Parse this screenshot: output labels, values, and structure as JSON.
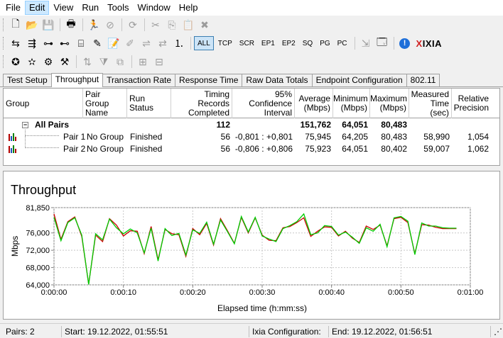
{
  "menu": [
    "File",
    "Edit",
    "View",
    "Run",
    "Tools",
    "Window",
    "Help"
  ],
  "menu_active": "Edit",
  "toolbar_protocols": [
    "ALL",
    "TCP",
    "SCR",
    "EP1",
    "EP2",
    "SQ",
    "PG",
    "PC"
  ],
  "brand": {
    "prefix": "",
    "x": "X",
    "rest": "IXIA"
  },
  "tabs": [
    "Test Setup",
    "Throughput",
    "Transaction Rate",
    "Response Time",
    "Raw Data Totals",
    "Endpoint Configuration",
    "802.11"
  ],
  "active_tab": "Throughput",
  "table": {
    "headers": {
      "group": "Group",
      "pair_group": "Pair Group Name",
      "run_status": "Run Status",
      "timing": "Timing Records Completed",
      "confidence": "95% Confidence Interval",
      "average": "Average (Mbps)",
      "minimum": "Minimum (Mbps)",
      "maximum": "Maximum (Mbps)",
      "measured": "Measured Time (sec)",
      "relative": "Relative Precision"
    },
    "all_pairs": {
      "label": "All Pairs",
      "timing": "112",
      "average": "151,762",
      "minimum": "64,051",
      "maximum": "80,483"
    },
    "rows": [
      {
        "pair": "Pair 1",
        "group": "No Group",
        "status": "Finished",
        "timing": "56",
        "confidence": "-0,801 : +0,801",
        "average": "75,945",
        "minimum": "64,205",
        "maximum": "80,483",
        "measured": "58,990",
        "relative": "1,054"
      },
      {
        "pair": "Pair 2",
        "group": "No Group",
        "status": "Finished",
        "timing": "56",
        "confidence": "-0,806 : +0,806",
        "average": "75,923",
        "minimum": "64,051",
        "maximum": "80,402",
        "measured": "59,007",
        "relative": "1,062"
      }
    ]
  },
  "chart_data": {
    "type": "line",
    "title": "Throughput",
    "xlabel": "Elapsed time (h:mm:ss)",
    "ylabel": "Mbps",
    "yticks": [
      "64,000",
      "68,000",
      "72,000",
      "76,000",
      "81,850"
    ],
    "ytick_values": [
      64,
      68,
      72,
      76,
      81.85
    ],
    "xticks": [
      "0:00:00",
      "0:00:10",
      "0:00:20",
      "0:00:30",
      "0:00:40",
      "0:00:50",
      "0:01:00"
    ],
    "ylim": [
      64,
      81.85
    ],
    "xlim": [
      0,
      60
    ],
    "grid": true,
    "colors": {
      "Pair 1": "#cc0000",
      "Pair 2": "#00cc00"
    },
    "series": [
      {
        "name": "Pair 1",
        "color": "#cc0000",
        "x": [
          0,
          1,
          2,
          3,
          4,
          5,
          6,
          7,
          8,
          9,
          10,
          11,
          12,
          13,
          14,
          15,
          16,
          17,
          18,
          19,
          20,
          21,
          22,
          23,
          24,
          25,
          26,
          27,
          28,
          29,
          30,
          31,
          32,
          33,
          34,
          35,
          36,
          37,
          38,
          39,
          40,
          41,
          42,
          43,
          44,
          45,
          46,
          47,
          48,
          49,
          50,
          51,
          52,
          53,
          54,
          55,
          56,
          57,
          58
        ],
        "values": [
          80.4,
          74.5,
          78.6,
          79.7,
          75.2,
          64.2,
          75.5,
          74.0,
          79.3,
          77.8,
          75.3,
          76.5,
          76.4,
          71.2,
          77.5,
          69.8,
          76.8,
          75.8,
          75.6,
          70.6,
          77.0,
          75.6,
          78.2,
          73.2,
          79.3,
          76.5,
          73.6,
          79.6,
          76.0,
          79.5,
          75.5,
          74.3,
          74.2,
          77.2,
          77.5,
          78.4,
          79.5,
          75.2,
          76.4,
          77.4,
          77.3,
          75.3,
          76.4,
          74.8,
          73.8,
          77.6,
          76.8,
          77.8,
          73.0,
          79.3,
          79.6,
          78.4,
          71.2,
          77.9,
          77.8,
          77.3,
          77.0,
          77.0,
          77.0
        ]
      },
      {
        "name": "Pair 2",
        "color": "#00cc00",
        "x": [
          0,
          1,
          2,
          3,
          4,
          5,
          6,
          7,
          8,
          9,
          10,
          11,
          12,
          13,
          14,
          15,
          16,
          17,
          18,
          19,
          20,
          21,
          22,
          23,
          24,
          25,
          26,
          27,
          28,
          29,
          30,
          31,
          32,
          33,
          34,
          35,
          36,
          37,
          38,
          39,
          40,
          41,
          42,
          43,
          44,
          45,
          46,
          47,
          48,
          49,
          50,
          51,
          52,
          53,
          54,
          55,
          56,
          57,
          58
        ],
        "values": [
          79.6,
          74.2,
          78.4,
          79.5,
          75.5,
          64.1,
          75.8,
          74.4,
          79.2,
          77.2,
          75.8,
          76.9,
          76.0,
          71.4,
          77.1,
          69.5,
          77.0,
          75.4,
          75.9,
          70.9,
          76.7,
          75.9,
          78.5,
          73.4,
          79.0,
          76.3,
          73.5,
          79.8,
          76.2,
          79.6,
          75.3,
          74.6,
          74.0,
          77.0,
          77.7,
          78.6,
          80.4,
          75.6,
          76.0,
          77.7,
          77.5,
          75.5,
          76.2,
          75.0,
          73.6,
          77.2,
          76.4,
          78.0,
          72.8,
          79.5,
          79.8,
          78.7,
          71.0,
          78.3,
          77.6,
          77.6,
          77.2,
          77.1,
          77.1
        ]
      }
    ]
  },
  "status": {
    "pairs": "Pairs: 2",
    "start": "Start: 19.12.2022, 01:55:51",
    "ixia": "Ixia Configuration:",
    "end": "End: 19.12.2022, 01:56:51"
  }
}
